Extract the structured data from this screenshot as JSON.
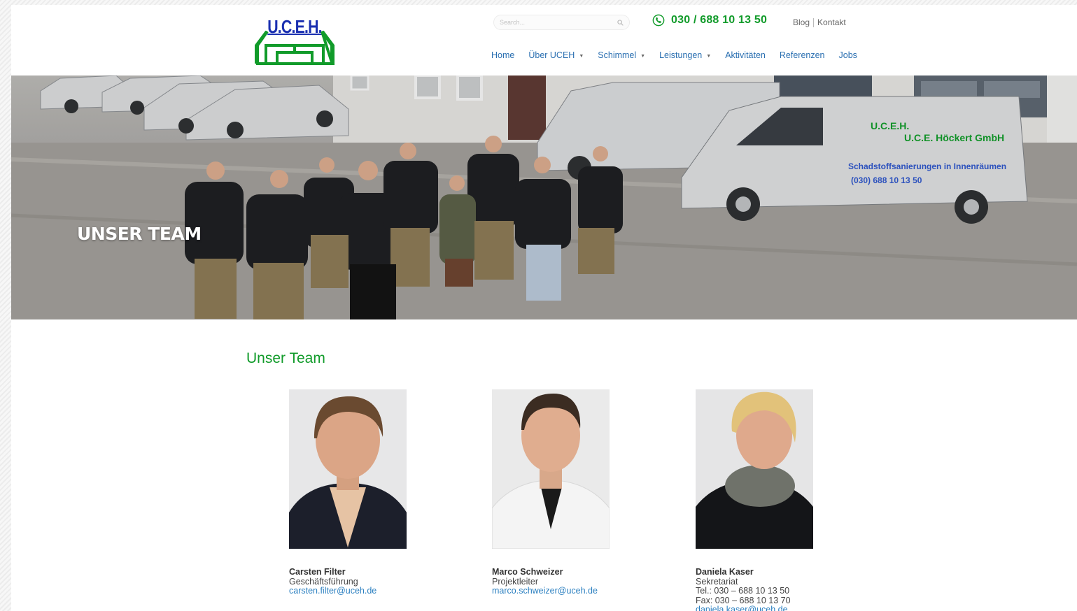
{
  "brand": {
    "logo_text": "U.C.E.H.",
    "logo_color": "#1a2fb0",
    "green": "#119b2a"
  },
  "search": {
    "placeholder": "Search..."
  },
  "phone": {
    "icon": "phone-icon",
    "number": "030 / 688 10 13 50"
  },
  "top_links": {
    "blog": "Blog",
    "kontakt": "Kontakt"
  },
  "nav": {
    "items": [
      {
        "label": "Home",
        "has_dropdown": false
      },
      {
        "label": "Über UCEH",
        "has_dropdown": true
      },
      {
        "label": "Schimmel",
        "has_dropdown": true
      },
      {
        "label": "Leistungen",
        "has_dropdown": true
      },
      {
        "label": "Aktivitäten",
        "has_dropdown": false
      },
      {
        "label": "Referenzen",
        "has_dropdown": false
      },
      {
        "label": "Jobs",
        "has_dropdown": false
      }
    ],
    "color": "#2a6fb1"
  },
  "hero": {
    "title": "UNSER TEAM",
    "van_logo": "U.C.E.H.",
    "van_company": "U.C.E. Höckert GmbH",
    "van_slogan": "Schadstoffsanierungen in Innenräumen",
    "van_phone": "(030) 688 10 13 50"
  },
  "main": {
    "heading": "Unser Team",
    "members": [
      {
        "name": "Carsten Filter",
        "role": "Geschäftsführung",
        "tel": "",
        "fax": "",
        "email": "carsten.filter@uceh.de"
      },
      {
        "name": "Marco Schweizer",
        "role": "Projektleiter",
        "tel": "",
        "fax": "",
        "email": "marco.schweizer@uceh.de"
      },
      {
        "name": "Daniela Kaser",
        "role": "Sekretariat",
        "tel": "Tel.: 030 – 688 10 13 50",
        "fax": "Fax: 030 – 688 10 13 70",
        "email": "daniela.kaser@uceh.de"
      }
    ]
  }
}
